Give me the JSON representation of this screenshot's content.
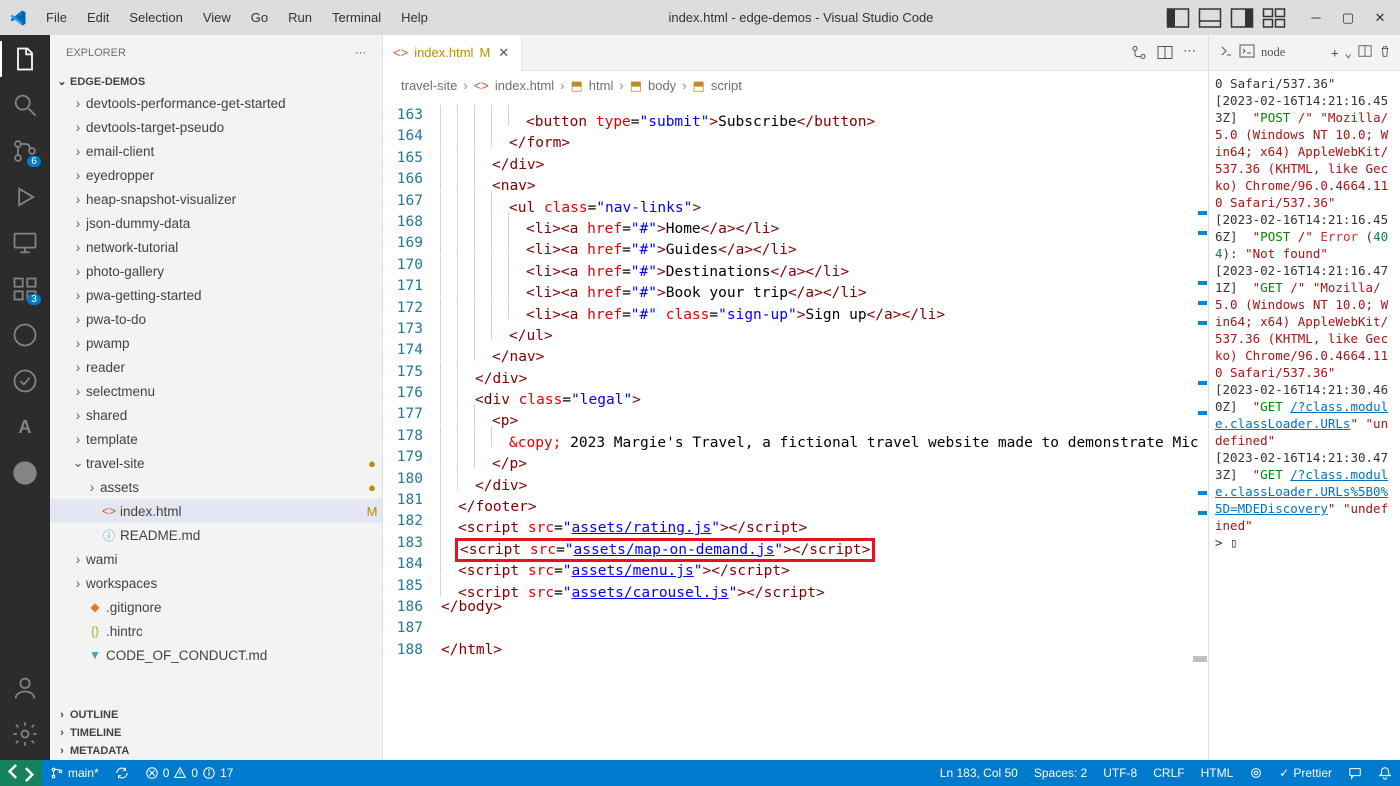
{
  "window": {
    "title": "index.html - edge-demos - Visual Studio Code"
  },
  "menu": {
    "file": "File",
    "edit": "Edit",
    "selection": "Selection",
    "view": "View",
    "go": "Go",
    "run": "Run",
    "terminal": "Terminal",
    "help": "Help"
  },
  "activity": {
    "scm_badge": "6",
    "ext_badge": "3"
  },
  "sidebar": {
    "title": "EXPLORER",
    "project": "EDGE-DEMOS",
    "items": [
      {
        "label": "devtools-performance-get-started",
        "chev": "›",
        "indent": 1
      },
      {
        "label": "devtools-target-pseudo",
        "chev": "›",
        "indent": 1
      },
      {
        "label": "email-client",
        "chev": "›",
        "indent": 1
      },
      {
        "label": "eyedropper",
        "chev": "›",
        "indent": 1
      },
      {
        "label": "heap-snapshot-visualizer",
        "chev": "›",
        "indent": 1
      },
      {
        "label": "json-dummy-data",
        "chev": "›",
        "indent": 1
      },
      {
        "label": "network-tutorial",
        "chev": "›",
        "indent": 1
      },
      {
        "label": "photo-gallery",
        "chev": "›",
        "indent": 1
      },
      {
        "label": "pwa-getting-started",
        "chev": "›",
        "indent": 1
      },
      {
        "label": "pwa-to-do",
        "chev": "›",
        "indent": 1
      },
      {
        "label": "pwamp",
        "chev": "›",
        "indent": 1
      },
      {
        "label": "reader",
        "chev": "›",
        "indent": 1
      },
      {
        "label": "selectmenu",
        "chev": "›",
        "indent": 1
      },
      {
        "label": "shared",
        "chev": "›",
        "indent": 1
      },
      {
        "label": "template",
        "chev": "›",
        "indent": 1
      },
      {
        "label": "travel-site",
        "chev": "⌄",
        "indent": 1,
        "status": "●"
      },
      {
        "label": "assets",
        "chev": "›",
        "indent": 2,
        "status": "●"
      },
      {
        "label": "index.html",
        "icon": "<>",
        "iconcolor": "#c75831",
        "indent": 2,
        "status": "M",
        "selected": true
      },
      {
        "label": "README.md",
        "icon": "ⓘ",
        "iconcolor": "#519aba",
        "indent": 2
      },
      {
        "label": "wami",
        "chev": "›",
        "indent": 1
      },
      {
        "label": "workspaces",
        "chev": "›",
        "indent": 1
      },
      {
        "label": ".gitignore",
        "icon": "◆",
        "iconcolor": "#e37933",
        "indent": 1
      },
      {
        "label": ".hintrc",
        "icon": "{}",
        "iconcolor": "#b8a11e",
        "indent": 1
      },
      {
        "label": "CODE_OF_CONDUCT.md",
        "icon": "▼",
        "iconcolor": "#519aba",
        "indent": 1
      }
    ],
    "outline": "OUTLINE",
    "timeline": "TIMELINE",
    "metadata": "METADATA"
  },
  "tab": {
    "name": "index.html",
    "mod": "M",
    "close": "✕"
  },
  "breadcrumb": {
    "a": "travel-site",
    "b": "index.html",
    "c": "html",
    "d": "body",
    "e": "script"
  },
  "editor": {
    "lines": {
      "163": {
        "indent": 5,
        "html": "<span class='t-pun'>&lt;</span><span class='t-tag'>button</span> <span class='t-attr'>type</span>=<span class='t-str'>\"submit\"</span><span class='t-pun'>&gt;</span><span class='t-txt'>Subscribe</span><span class='t-pun'>&lt;/</span><span class='t-tag'>button</span><span class='t-pun'>&gt;</span>"
      },
      "164": {
        "indent": 4,
        "html": "<span class='t-pun'>&lt;/</span><span class='t-tag'>form</span><span class='t-pun'>&gt;</span>"
      },
      "165": {
        "indent": 3,
        "html": "<span class='t-pun'>&lt;/</span><span class='t-tag'>div</span><span class='t-pun'>&gt;</span>"
      },
      "166": {
        "indent": 3,
        "html": "<span class='t-pun'>&lt;</span><span class='t-tag'>nav</span><span class='t-pun'>&gt;</span>"
      },
      "167": {
        "indent": 4,
        "html": "<span class='t-pun'>&lt;</span><span class='t-tag'>ul</span> <span class='t-attr'>class</span>=<span class='t-str'>\"nav-links\"</span><span class='t-pun'>&gt;</span>"
      },
      "168": {
        "indent": 5,
        "html": "<span class='t-pun'>&lt;</span><span class='t-tag'>li</span><span class='t-pun'>&gt;&lt;</span><span class='t-tag'>a</span> <span class='t-attr'>href</span>=<span class='t-str'>\"#\"</span><span class='t-pun'>&gt;</span><span class='t-txt'>Home</span><span class='t-pun'>&lt;/</span><span class='t-tag'>a</span><span class='t-pun'>&gt;&lt;/</span><span class='t-tag'>li</span><span class='t-pun'>&gt;</span>"
      },
      "169": {
        "indent": 5,
        "html": "<span class='t-pun'>&lt;</span><span class='t-tag'>li</span><span class='t-pun'>&gt;&lt;</span><span class='t-tag'>a</span> <span class='t-attr'>href</span>=<span class='t-str'>\"#\"</span><span class='t-pun'>&gt;</span><span class='t-txt'>Guides</span><span class='t-pun'>&lt;/</span><span class='t-tag'>a</span><span class='t-pun'>&gt;&lt;/</span><span class='t-tag'>li</span><span class='t-pun'>&gt;</span>"
      },
      "170": {
        "indent": 5,
        "html": "<span class='t-pun'>&lt;</span><span class='t-tag'>li</span><span class='t-pun'>&gt;&lt;</span><span class='t-tag'>a</span> <span class='t-attr'>href</span>=<span class='t-str'>\"#\"</span><span class='t-pun'>&gt;</span><span class='t-txt'>Destinations</span><span class='t-pun'>&lt;/</span><span class='t-tag'>a</span><span class='t-pun'>&gt;&lt;/</span><span class='t-tag'>li</span><span class='t-pun'>&gt;</span>"
      },
      "171": {
        "indent": 5,
        "html": "<span class='t-pun'>&lt;</span><span class='t-tag'>li</span><span class='t-pun'>&gt;&lt;</span><span class='t-tag'>a</span> <span class='t-attr'>href</span>=<span class='t-str'>\"#\"</span><span class='t-pun'>&gt;</span><span class='t-txt'>Book your trip</span><span class='t-pun'>&lt;/</span><span class='t-tag'>a</span><span class='t-pun'>&gt;&lt;/</span><span class='t-tag'>li</span><span class='t-pun'>&gt;</span>"
      },
      "172": {
        "indent": 5,
        "html": "<span class='t-pun'>&lt;</span><span class='t-tag'>li</span><span class='t-pun'>&gt;&lt;</span><span class='t-tag'>a</span> <span class='t-attr'>href</span>=<span class='t-str'>\"#\"</span> <span class='t-attr'>class</span>=<span class='t-str'>\"sign-up\"</span><span class='t-pun'>&gt;</span><span class='t-txt'>Sign up</span><span class='t-pun'>&lt;/</span><span class='t-tag'>a</span><span class='t-pun'>&gt;&lt;/</span><span class='t-tag'>li</span><span class='t-pun'>&gt;</span>"
      },
      "173": {
        "indent": 4,
        "html": "<span class='t-pun'>&lt;/</span><span class='t-tag'>ul</span><span class='t-pun'>&gt;</span>"
      },
      "174": {
        "indent": 3,
        "html": "<span class='t-pun'>&lt;/</span><span class='t-tag'>nav</span><span class='t-pun'>&gt;</span>"
      },
      "175": {
        "indent": 2,
        "html": "<span class='t-pun'>&lt;/</span><span class='t-tag'>div</span><span class='t-pun'>&gt;</span>"
      },
      "176": {
        "indent": 2,
        "html": "<span class='t-pun'>&lt;</span><span class='t-tag'>div</span> <span class='t-attr'>class</span>=<span class='t-str'>\"legal\"</span><span class='t-pun'>&gt;</span>"
      },
      "177": {
        "indent": 3,
        "html": "<span class='t-pun'>&lt;</span><span class='t-tag'>p</span><span class='t-pun'>&gt;</span>"
      },
      "178": {
        "indent": 4,
        "html": "<span class='t-ent'>&amp;copy;</span> <span class='t-txt'>2023 Margie's Travel, a fictional travel website made to demonstrate Mic</span>"
      },
      "179": {
        "indent": 3,
        "html": "<span class='t-pun'>&lt;/</span><span class='t-tag'>p</span><span class='t-pun'>&gt;</span>"
      },
      "180": {
        "indent": 2,
        "html": "<span class='t-pun'>&lt;/</span><span class='t-tag'>div</span><span class='t-pun'>&gt;</span>"
      },
      "181": {
        "indent": 1,
        "html": "<span class='t-pun'>&lt;/</span><span class='t-tag'>footer</span><span class='t-pun'>&gt;</span>"
      },
      "182": {
        "indent": 1,
        "html": "<span class='t-pun'>&lt;</span><span class='t-tag'>script</span> <span class='t-attr'>src</span>=<span class='t-str'>\"</span><span class='t-link'>assets/rating.js</span><span class='t-str'>\"</span><span class='t-pun'>&gt;&lt;/</span><span class='t-tag'>script</span><span class='t-pun'>&gt;</span>"
      },
      "183": {
        "indent": 1,
        "boxed": true,
        "html": "<span class='t-pun'>&lt;</span><span class='t-tag'>script</span> <span class='t-attr'>src</span>=<span class='t-str'>\"</span><span class='t-link'>assets/map-on-demand.js</span><span class='t-str'>\"</span><span class='t-pun'>&gt;&lt;/</span><span class='t-tag'>script</span><span class='t-pun'>&gt;</span>"
      },
      "184": {
        "indent": 1,
        "html": "<span class='t-pun'>&lt;</span><span class='t-tag'>script</span> <span class='t-attr'>src</span>=<span class='t-str'>\"</span><span class='t-link'>assets/menu.js</span><span class='t-str'>\"</span><span class='t-pun'>&gt;&lt;/</span><span class='t-tag'>script</span><span class='t-pun'>&gt;</span>"
      },
      "185": {
        "indent": 1,
        "html": "<span class='t-pun'>&lt;</span><span class='t-tag'>script</span> <span class='t-attr'>src</span>=<span class='t-str'>\"</span><span class='t-link'>assets/carousel.js</span><span class='t-str'>\"</span><span class='t-pun'>&gt;&lt;/</span><span class='t-tag'>script</span><span class='t-pun'>&gt;</span>"
      },
      "186": {
        "indent": 0,
        "html": "<span class='t-pun'>&lt;/</span><span class='t-tag'>body</span><span class='t-pun'>&gt;</span>"
      },
      "187": {
        "indent": 0,
        "html": ""
      },
      "188": {
        "indent": 0,
        "html": "<span class='t-pun'>&lt;/</span><span class='t-tag'>html</span><span class='t-pun'>&gt;</span>"
      }
    }
  },
  "panel": {
    "node": "node",
    "log": "0 Safari/537.36\"\n[2023-02-16T14:21:16.453Z]  <span class='pt-str'>\"</span><span class='pt-ok'>POST</span><span class='pt-str'> /\"</span> <span class='pt-str'>\"Mozilla/5.0 (Windows NT 10.0; Win64; x64) AppleWebKit/537.36 (KHTML, like Gecko) Chrome/96.0.4664.110 Safari/537.36\"</span>\n[2023-02-16T14:21:16.456Z]  <span class='pt-str'>\"</span><span class='pt-ok'>POST</span><span class='pt-str'> /\"</span> <span class='pt-err'>Error</span> (<span class='pt-num'>404</span>): <span class='pt-str'>\"Not found\"</span>\n[2023-02-16T14:21:16.471Z]  <span class='pt-str'>\"</span><span class='pt-ok'>GET</span><span class='pt-str'> /\"</span> <span class='pt-str'>\"Mozilla/5.0 (Windows NT 10.0; Win64; x64) AppleWebKit/537.36 (KHTML, like Gecko) Chrome/96.0.4664.110 Safari/537.36\"</span>\n[2023-02-16T14:21:30.460Z]  <span class='pt-str'>\"</span><span class='pt-ok'>GET</span><span class='pt-str'> </span><span class='pt-link'>/?class.module.classLoader.URLs</span><span class='pt-str'>\"</span> <span class='pt-str'>\"undefined\"</span>\n[2023-02-16T14:21:30.473Z]  <span class='pt-str'>\"</span><span class='pt-ok'>GET</span><span class='pt-str'> </span><span class='pt-link'>/?class.module.classLoader.URLs%5B0%5D=MDEDiscovery</span><span class='pt-str'>\"</span> <span class='pt-str'>\"undefined\"</span>\n&gt; ▯"
  },
  "status": {
    "branch": "main*",
    "errors": "0",
    "warnings": "0",
    "info": "17",
    "pos": "Ln 183, Col 50",
    "spaces": "Spaces: 2",
    "enc": "UTF-8",
    "eol": "CRLF",
    "lang": "HTML",
    "prettier": "Prettier"
  }
}
